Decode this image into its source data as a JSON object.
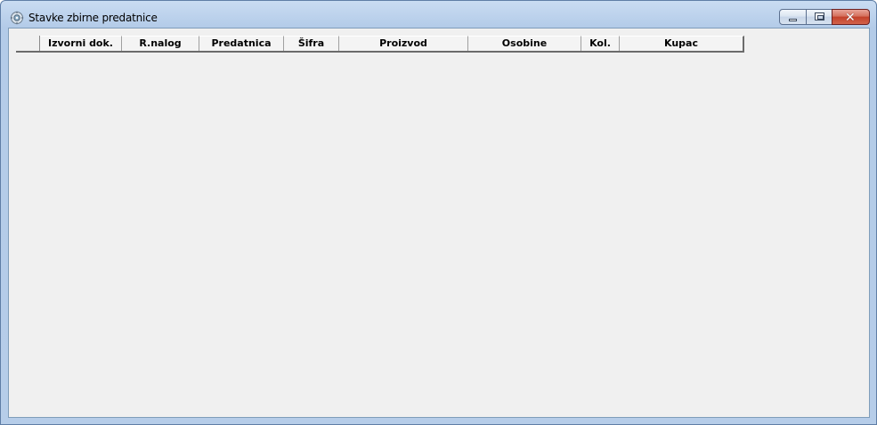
{
  "window": {
    "title": "Stavke zbirne predatnice"
  },
  "grid": {
    "columns": [
      {
        "label": "Izvorni dok."
      },
      {
        "label": "R.nalog"
      },
      {
        "label": "Predatnica"
      },
      {
        "label": "Šifra"
      },
      {
        "label": "Proizvod"
      },
      {
        "label": "Osobine"
      },
      {
        "label": "Kol."
      },
      {
        "label": "Kupac"
      }
    ]
  }
}
